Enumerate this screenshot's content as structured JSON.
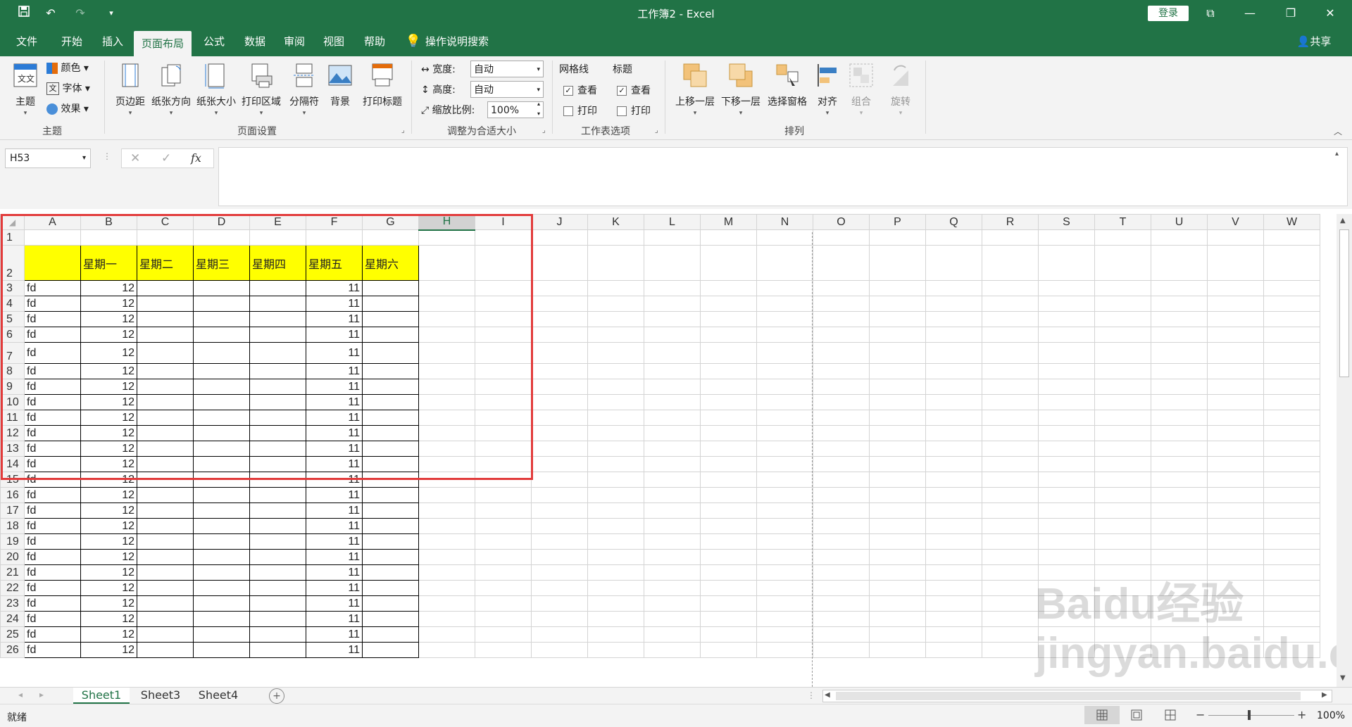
{
  "window": {
    "title": "工作簿2 - Excel",
    "login": "登录"
  },
  "tabs": [
    "文件",
    "开始",
    "插入",
    "页面布局",
    "公式",
    "数据",
    "审阅",
    "视图",
    "帮助"
  ],
  "tell_me": "操作说明搜索",
  "share": "共享",
  "ribbon": {
    "theme_group": {
      "label": "主题",
      "theme": "主题",
      "colors": "颜色",
      "fonts": "字体",
      "effects": "效果"
    },
    "page_setup_group": {
      "label": "页面设置",
      "buttons": [
        "页边距",
        "纸张方向",
        "纸张大小",
        "打印区域",
        "分隔符",
        "背景",
        "打印标题"
      ]
    },
    "scale_group": {
      "label": "调整为合适大小",
      "width_label": "宽度:",
      "width_value": "自动",
      "height_label": "高度:",
      "height_value": "自动",
      "scale_label": "缩放比例:",
      "scale_value": "100%"
    },
    "sheet_options_group": {
      "label": "工作表选项",
      "gridlines": "网格线",
      "headings": "标题",
      "view": "查看",
      "print": "打印"
    },
    "arrange_group": {
      "label": "排列",
      "buttons": [
        "上移一层",
        "下移一层",
        "选择窗格",
        "对齐",
        "组合",
        "旋转"
      ]
    }
  },
  "formula_bar": {
    "name_box": "H53",
    "fx": "fx"
  },
  "columns": [
    "A",
    "B",
    "C",
    "D",
    "E",
    "F",
    "G",
    "H",
    "I",
    "J",
    "K",
    "L",
    "M",
    "N",
    "O",
    "P",
    "Q",
    "R",
    "S",
    "T",
    "U",
    "V",
    "W"
  ],
  "selected_column": "H",
  "header_row": [
    "",
    "星期一",
    "星期二",
    "星期三",
    "星期四",
    "星期五",
    "星期六"
  ],
  "data_rows": [
    {
      "row": "3",
      "a": "fd",
      "b": "12",
      "f": "11"
    },
    {
      "row": "4",
      "a": "fd",
      "b": "12",
      "f": "11"
    },
    {
      "row": "5",
      "a": "fd",
      "b": "12",
      "f": "11"
    },
    {
      "row": "6",
      "a": "fd",
      "b": "12",
      "f": "11"
    },
    {
      "row": "7",
      "a": "fd",
      "b": "12",
      "f": "11"
    },
    {
      "row": "8",
      "a": "fd",
      "b": "12",
      "f": "11"
    },
    {
      "row": "9",
      "a": "fd",
      "b": "12",
      "f": "11"
    },
    {
      "row": "10",
      "a": "fd",
      "b": "12",
      "f": "11"
    },
    {
      "row": "11",
      "a": "fd",
      "b": "12",
      "f": "11"
    },
    {
      "row": "12",
      "a": "fd",
      "b": "12",
      "f": "11"
    },
    {
      "row": "13",
      "a": "fd",
      "b": "12",
      "f": "11"
    },
    {
      "row": "14",
      "a": "fd",
      "b": "12",
      "f": "11"
    },
    {
      "row": "15",
      "a": "fd",
      "b": "12",
      "f": "11"
    },
    {
      "row": "16",
      "a": "fd",
      "b": "12",
      "f": "11"
    },
    {
      "row": "17",
      "a": "fd",
      "b": "12",
      "f": "11"
    },
    {
      "row": "18",
      "a": "fd",
      "b": "12",
      "f": "11"
    },
    {
      "row": "19",
      "a": "fd",
      "b": "12",
      "f": "11"
    },
    {
      "row": "20",
      "a": "fd",
      "b": "12",
      "f": "11"
    },
    {
      "row": "21",
      "a": "fd",
      "b": "12",
      "f": "11"
    },
    {
      "row": "22",
      "a": "fd",
      "b": "12",
      "f": "11"
    },
    {
      "row": "23",
      "a": "fd",
      "b": "12",
      "f": "11"
    },
    {
      "row": "24",
      "a": "fd",
      "b": "12",
      "f": "11"
    },
    {
      "row": "25",
      "a": "fd",
      "b": "12",
      "f": "11"
    },
    {
      "row": "26",
      "a": "fd",
      "b": "12",
      "f": "11"
    }
  ],
  "sheet_tabs": [
    "Sheet1",
    "Sheet3",
    "Sheet4"
  ],
  "active_sheet": "Sheet1",
  "status": {
    "ready": "就绪",
    "zoom": "100%"
  },
  "watermark": "Baidu经验 jingyan.baidu.com",
  "colors": {
    "excel_green": "#217346",
    "highlight_yellow": "#ffff00",
    "annotation_red": "#e23b3b"
  }
}
